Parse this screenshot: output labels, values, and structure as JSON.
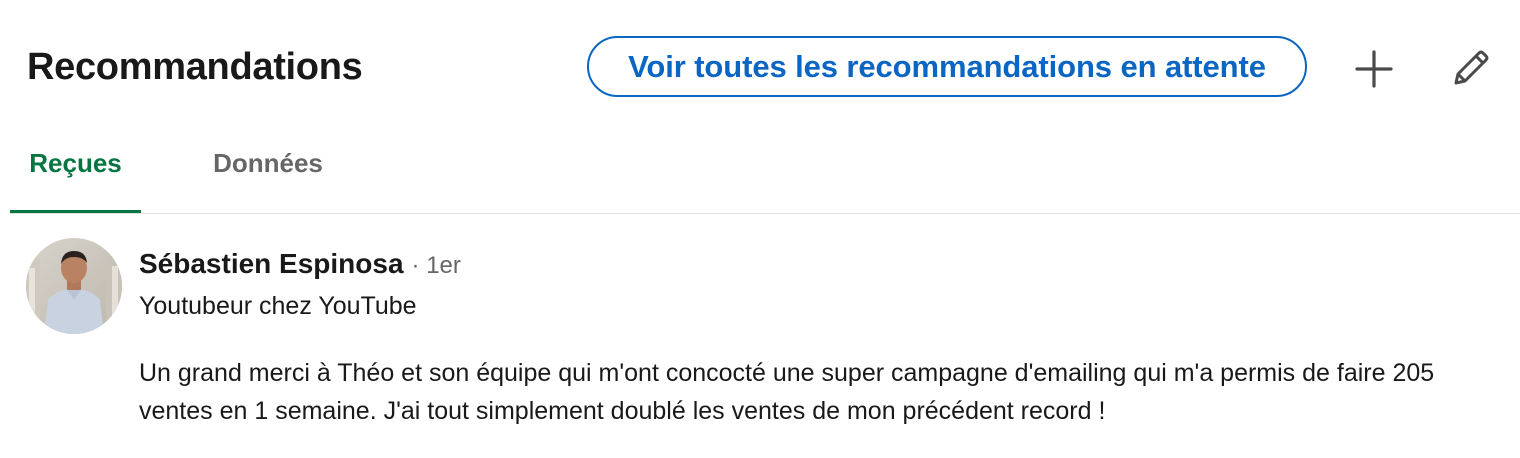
{
  "section": {
    "title": "Recommandations",
    "pending_button": "Voir toutes les recommandations en attente",
    "add_icon": "plus-icon",
    "edit_icon": "pencil-icon"
  },
  "tabs": [
    {
      "label": "Reçues",
      "active": true
    },
    {
      "label": "Données",
      "active": false
    }
  ],
  "colors": {
    "accent_blue": "#0a66c2",
    "active_tab_green": "#057642",
    "muted_text": "#666666"
  },
  "recommendation": {
    "name": "Sébastien Espinosa",
    "degree": "· 1er",
    "headline": "Youtubeur chez YouTube",
    "text": "Un grand merci à Théo et son équipe qui m'ont concocté une super campagne d'emailing qui m'a permis de faire 205 ventes en 1 semaine. J'ai tout simplement doublé les ventes de mon précédent record !"
  }
}
